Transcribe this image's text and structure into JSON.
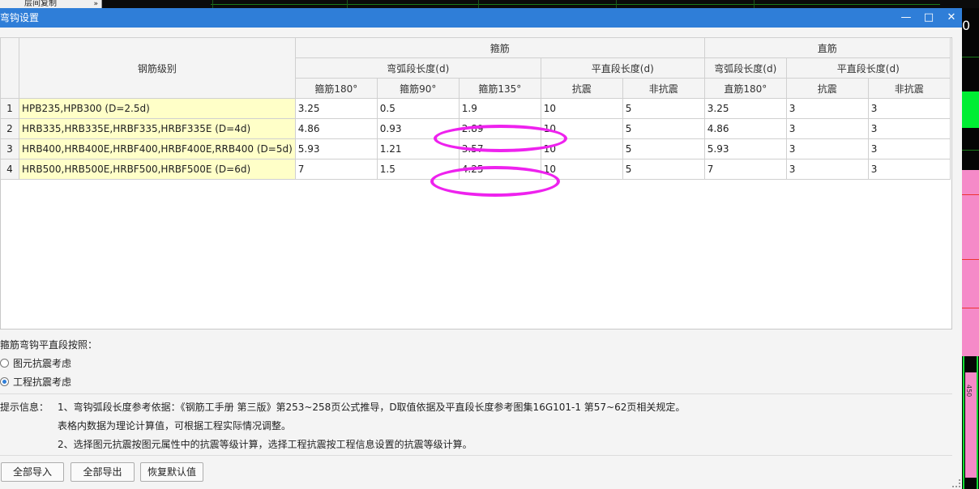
{
  "background": {
    "tab_label": "层间复制",
    "tab_arrow": "»",
    "right_text": "0",
    "side_text": "450"
  },
  "dialog": {
    "title": "弯钩设置",
    "controls": {
      "minimize": "—",
      "maximize": "□",
      "close": "✕"
    }
  },
  "grid": {
    "grade_header": "钢筋级别",
    "group_headers": {
      "stirrup": "箍筋",
      "straight": "直筋"
    },
    "sub_headers": {
      "stirrup_arc": "弯弧段长度(d)",
      "stirrup_flat": "平直段长度(d)",
      "straight_arc": "弯弧段长度(d)",
      "straight_flat": "平直段长度(d)"
    },
    "columns": [
      "箍筋180°",
      "箍筋90°",
      "箍筋135°",
      "抗震",
      "非抗震",
      "直筋180°",
      "抗震",
      "非抗震"
    ],
    "rows": [
      {
        "num": "1",
        "grade": "HPB235,HPB300 (D=2.5d)",
        "values": [
          "3.25",
          "0.5",
          "1.9",
          "10",
          "5",
          "3.25",
          "3",
          "3"
        ]
      },
      {
        "num": "2",
        "grade": "HRB335,HRB335E,HRBF335,HRBF335E (D=4d)",
        "values": [
          "4.86",
          "0.93",
          "2.89",
          "10",
          "5",
          "4.86",
          "3",
          "3"
        ]
      },
      {
        "num": "3",
        "grade": "HRB400,HRB400E,HRBF400,HRBF400E,RRB400 (D=5d)",
        "values": [
          "5.93",
          "1.21",
          "3.57",
          "10",
          "5",
          "5.93",
          "3",
          "3"
        ]
      },
      {
        "num": "4",
        "grade": "HRB500,HRB500E,HRBF500,HRBF500E (D=6d)",
        "values": [
          "7",
          "1.5",
          "4.25",
          "10",
          "5",
          "7",
          "3",
          "3"
        ]
      }
    ],
    "highlight_color": "#ee22ee"
  },
  "options": {
    "label": "箍筋弯钩平直段按照：",
    "radio1": "图元抗震考虑",
    "radio2": "工程抗震考虑",
    "selected": "radio2"
  },
  "hints": {
    "label": "提示信息：",
    "line1": "1、弯钩弧段长度参考依据：《钢筋工手册 第三版》第253~258页公式推导，D取值依据及平直段长度参考图集16G101-1 第57~62页相关规定。",
    "line2": "表格内数据为理论计算值，可根据工程实际情况调整。",
    "line3": "2、选择图元抗震按图元属性中的抗震等级计算，选择工程抗震按工程信息设置的抗震等级计算。"
  },
  "buttons": {
    "import_all": "全部导入",
    "export_all": "全部导出",
    "restore_default": "恢复默认值"
  },
  "colors": {
    "titlebar": "#2f7ed8",
    "grade_cell": "#ffffc8",
    "accent_pink": "#f58ac8",
    "accent_green": "#00ee33"
  }
}
